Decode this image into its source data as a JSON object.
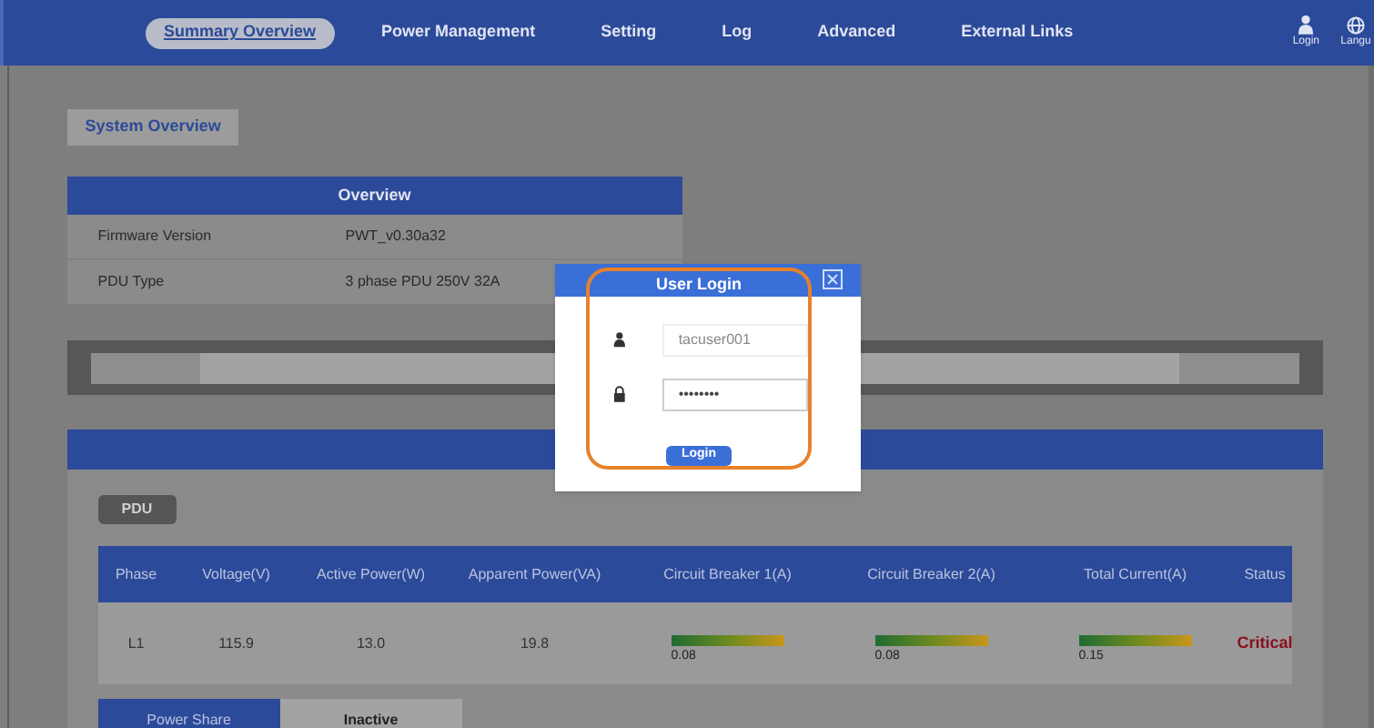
{
  "nav": {
    "items": [
      {
        "label": "Summary Overview",
        "selected": true
      },
      {
        "label": "Power Management",
        "selected": false
      },
      {
        "label": "Setting",
        "selected": false
      },
      {
        "label": "Log",
        "selected": false
      },
      {
        "label": "Advanced",
        "selected": false
      },
      {
        "label": "External Links",
        "selected": false
      }
    ],
    "login": "Login",
    "language": "Langu"
  },
  "page_tab": "System Overview",
  "overview": {
    "title": "Overview",
    "rows": [
      {
        "label": "Firmware Version",
        "value": "PWT_v0.30a32"
      },
      {
        "label": "PDU Type",
        "value": "3 phase PDU 250V 32A"
      }
    ]
  },
  "pdu": {
    "badge": "PDU",
    "columns": [
      "Phase",
      "Voltage(V)",
      "Active Power(W)",
      "Apparent Power(VA)",
      "Circuit Breaker 1(A)",
      "Circuit Breaker 2(A)",
      "Total Current(A)",
      "Status"
    ],
    "rows": [
      {
        "phase": "L1",
        "voltage": "115.9",
        "active": "13.0",
        "apparent": "19.8",
        "cb1": "0.08",
        "cb2": "0.08",
        "total": "0.15",
        "status": "Critical"
      }
    ]
  },
  "bottom_tabs": [
    {
      "label": "Power Share",
      "selected": true
    },
    {
      "label": "Inactive",
      "selected": false
    }
  ],
  "dialog": {
    "title": "User Login",
    "username": "tacuser001",
    "password": "••••••••",
    "button": "Login"
  }
}
